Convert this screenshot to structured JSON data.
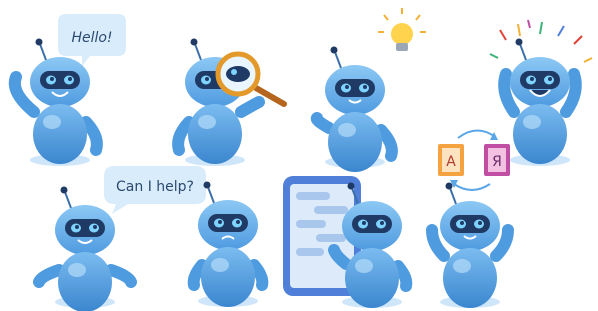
{
  "bubbles": {
    "hello": "Hello!",
    "help": "Can I help?"
  },
  "translate_cards": {
    "left_letter": "A",
    "right_letter": "Я"
  },
  "colors": {
    "robot_body": "#5aa6e6",
    "robot_body_dark": "#3b82c9",
    "robot_highlight": "#9fd0f7",
    "visor": "#1f3a64",
    "shadow": "#cfe6fa",
    "bubble": "#d9ecfb",
    "bulb": "#ffd34d",
    "magnifier_rim": "#e39a2b",
    "card_left": "#f4a340",
    "card_right": "#c04fa3",
    "tablet": "#4f7fd9"
  }
}
